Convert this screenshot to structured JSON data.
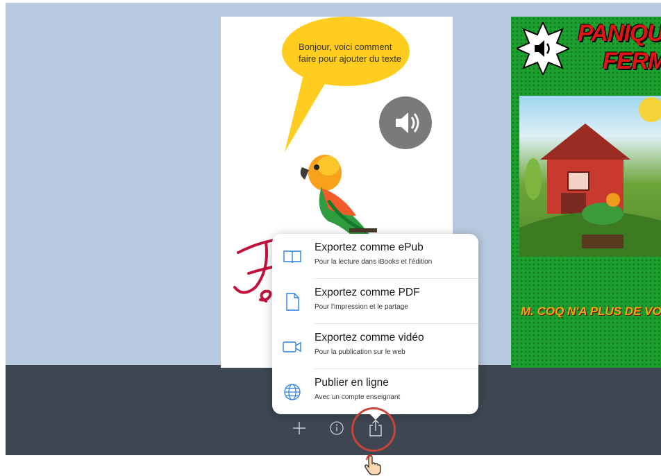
{
  "left_page": {
    "speech_bubble_text": "Bonjour, voici comment faire pour ajouter du texte"
  },
  "right_page": {
    "title_line1": "PANIQU",
    "title_line2": "FERM",
    "subtitle": "M. COQ N'A PLUS DE VO"
  },
  "export_menu": {
    "items": [
      {
        "title": "Exportez comme ePub",
        "subtitle": "Pour la lecture dans iBooks et l'édition",
        "icon": "book-icon"
      },
      {
        "title": "Exportez comme PDF",
        "subtitle": "Pour l'impression et le partage",
        "icon": "document-icon"
      },
      {
        "title": "Exportez comme vidéo",
        "subtitle": "Pour la publication sur le web",
        "icon": "video-camera-icon"
      },
      {
        "title": "Publier en ligne",
        "subtitle": "Avec un compte enseignant",
        "icon": "globe-icon"
      }
    ]
  },
  "toolbar": {
    "buttons": [
      "add-icon",
      "info-icon",
      "share-icon"
    ]
  },
  "colors": {
    "canvas_background": "#b8cadf",
    "bottom_bar": "#3e4652",
    "accent_blue": "#2f7fe0",
    "bubble_yellow": "#ffcd1f",
    "cover_green": "#1ea030",
    "highlight_red": "#c94439"
  }
}
